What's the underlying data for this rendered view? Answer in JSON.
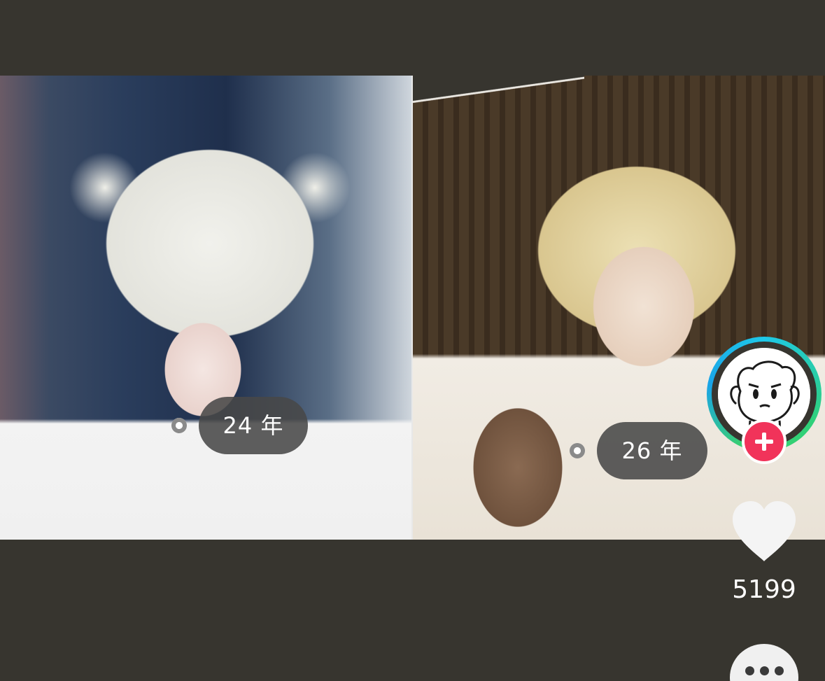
{
  "timeline": {
    "left_photo": {
      "year_label": "24 年"
    },
    "right_photo": {
      "year_label": "26 年"
    }
  },
  "actions": {
    "like_count": "5199"
  }
}
